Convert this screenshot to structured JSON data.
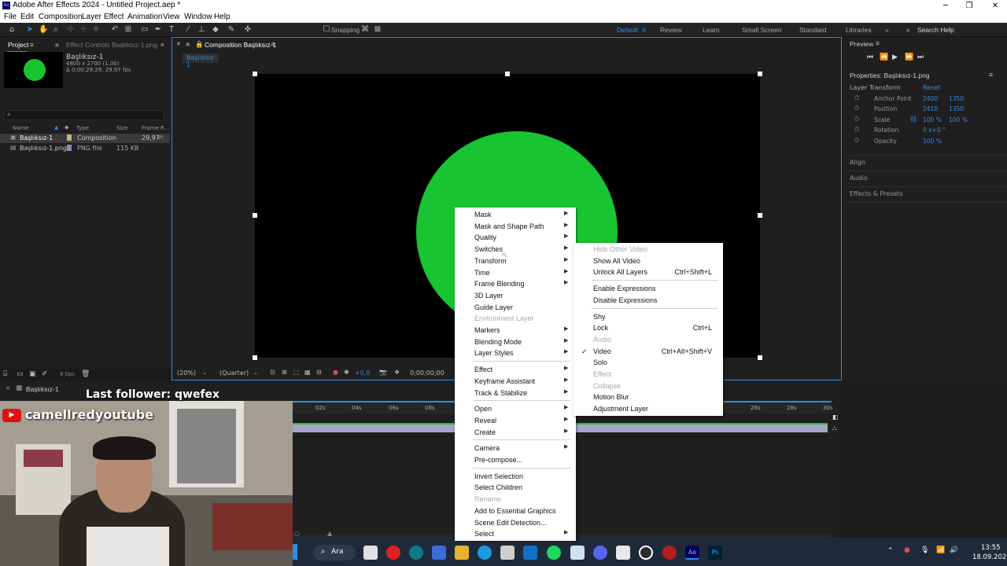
{
  "window": {
    "title": "Adobe After Effects 2024 - Untitled Project.aep *",
    "logo_text": "Ae"
  },
  "menubar": [
    "File",
    "Edit",
    "Composition",
    "Layer",
    "Effect",
    "Animation",
    "View",
    "Window",
    "Help"
  ],
  "toolbar": {
    "snapping": "Snapping",
    "workspaces": [
      "Default",
      "Review",
      "Learn",
      "Small Screen",
      "Standard",
      "Libraries"
    ],
    "search_help": "Search Help",
    "active_workspace": "Default"
  },
  "project_panel": {
    "tab_project": "Project",
    "tab_effect_controls": "Effect Controls Başlıksız-1.png",
    "item_name": "Başlıksız-1",
    "item_dims": "4800 x 2700 (1,00)",
    "item_duration": "Δ 0;00;29;29, 29,97 fps",
    "columns": [
      "Name",
      "Type",
      "Size",
      "Frame R..."
    ],
    "rows": [
      {
        "name": "Başlıksız-1",
        "type": "Composition",
        "size": "",
        "fps": "29,97"
      },
      {
        "name": "Başlıksız-1.png",
        "type": "PNG file",
        "size": "115 KB",
        "fps": ""
      }
    ],
    "bpc": "8 bpc"
  },
  "composition_panel": {
    "tab": "Composition Başlıksız-1",
    "crumb": "Başlıksız-1",
    "zoom": "(20%)",
    "resolution": "(Quarter)",
    "exposure": "+0,0",
    "timecode": "0;00;00;00"
  },
  "timeline": {
    "tab": "Başlıksız-1",
    "ticks": [
      "02s",
      "04s",
      "06s",
      "08s",
      "26s",
      "28s",
      "30s"
    ]
  },
  "overlay": {
    "follower": "Last follower: qwefex",
    "channel": "camellredyoutube"
  },
  "right_panel": {
    "preview": "Preview",
    "properties_title": "Properties: Başlıksız-1.png",
    "layer_transform": "Layer Transform",
    "reset": "Reset",
    "props": [
      {
        "label": "Anchor Point",
        "v1": "2400",
        "v2": "1350"
      },
      {
        "label": "Position",
        "v1": "2410",
        "v2": "1350"
      },
      {
        "label": "Scale",
        "v1": "100 %",
        "v2": "100 %"
      },
      {
        "label": "Rotation",
        "v1": "0 x+0 °",
        "v2": ""
      },
      {
        "label": "Opacity",
        "v1": "100 %",
        "v2": ""
      }
    ],
    "sections": [
      "Align",
      "Audio",
      "Effects & Presets"
    ]
  },
  "context_menu": {
    "items": [
      {
        "label": "Mask",
        "sub": true
      },
      {
        "label": "Mask and Shape Path",
        "sub": true
      },
      {
        "label": "Quality",
        "sub": true
      },
      {
        "label": "Switches",
        "sub": true
      },
      {
        "label": "Transform",
        "sub": true
      },
      {
        "label": "Time",
        "sub": true
      },
      {
        "label": "Frame Blending",
        "sub": true
      },
      {
        "label": "3D Layer"
      },
      {
        "label": "Guide Layer"
      },
      {
        "label": "Environment Layer",
        "disabled": true
      },
      {
        "label": "Markers",
        "sub": true
      },
      {
        "label": "Blending Mode",
        "sub": true
      },
      {
        "label": "Layer Styles",
        "sub": true
      },
      {
        "sep": true
      },
      {
        "label": "Effect",
        "sub": true
      },
      {
        "label": "Keyframe Assistant",
        "sub": true
      },
      {
        "label": "Track & Stabilize",
        "sub": true
      },
      {
        "sep": true
      },
      {
        "label": "Open",
        "sub": true
      },
      {
        "label": "Reveal",
        "sub": true
      },
      {
        "label": "Create",
        "sub": true
      },
      {
        "sep": true
      },
      {
        "label": "Camera",
        "sub": true
      },
      {
        "label": "Pre-compose..."
      },
      {
        "sep": true
      },
      {
        "label": "Invert Selection"
      },
      {
        "label": "Select Children"
      },
      {
        "label": "Rename",
        "disabled": true
      },
      {
        "label": "Add to Essential Graphics"
      },
      {
        "label": "Scene Edit Detection..."
      },
      {
        "label": "Select",
        "sub": true
      }
    ]
  },
  "switches_submenu": {
    "items": [
      {
        "label": "Hide Other Video",
        "disabled": true
      },
      {
        "label": "Show All Video"
      },
      {
        "label": "Unlock All Layers",
        "shortcut": "Ctrl+Shift+L"
      },
      {
        "sep": true
      },
      {
        "label": "Enable Expressions"
      },
      {
        "label": "Disable Expressions"
      },
      {
        "sep": true
      },
      {
        "label": "Shy"
      },
      {
        "label": "Lock",
        "shortcut": "Ctrl+L"
      },
      {
        "label": "Audio",
        "disabled": true
      },
      {
        "label": "Video",
        "shortcut": "Ctrl+Alt+Shift+V",
        "checked": true
      },
      {
        "label": "Solo"
      },
      {
        "label": "Effect",
        "disabled": true
      },
      {
        "label": "Collapse",
        "disabled": true
      },
      {
        "label": "Motion Blur"
      },
      {
        "label": "Adjustment Layer"
      }
    ]
  },
  "taskbar": {
    "search": "Ara",
    "time": "13:55",
    "date": "18.09.2025"
  }
}
